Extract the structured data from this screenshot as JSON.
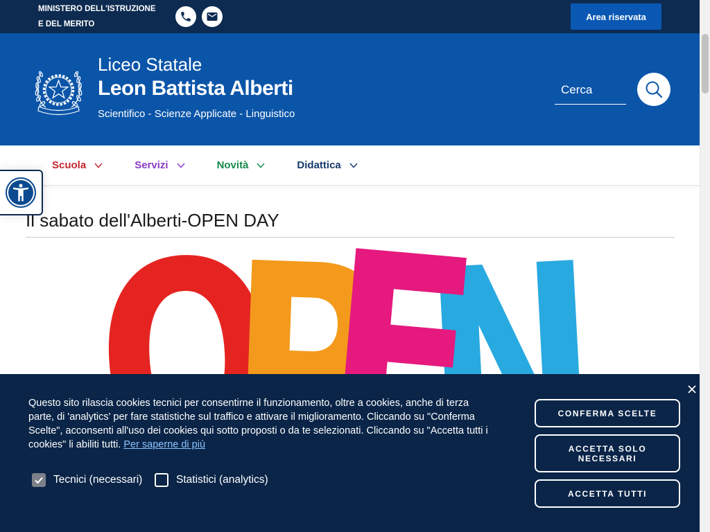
{
  "top_bar": {
    "ministry_line1": "MINISTERO DELL'ISTRUZIONE",
    "ministry_line2": "E DEL MERITO",
    "phone_icon": "phone-icon",
    "email_icon": "envelope-icon",
    "reserved_area_label": "Area riservata",
    "background": "#0d2b50"
  },
  "header": {
    "logo_icon": "italian-republic-emblem-icon",
    "kicker": "Liceo Statale",
    "school_name": "Leon Battista Alberti",
    "tagline": "Scientifico - Scienze Applicate - Linguistico",
    "search": {
      "label": "Cerca",
      "icon": "search-icon"
    },
    "background": "#0b55a9"
  },
  "nav": {
    "items": [
      {
        "label": "Scuola",
        "color": "#c1272d",
        "icon": "chevron-down-icon"
      },
      {
        "label": "Servizi",
        "color": "#8a3dc4",
        "icon": "chevron-down-icon"
      },
      {
        "label": "Novità",
        "color": "#17894b",
        "icon": "chevron-down-icon"
      },
      {
        "label": "Didattica",
        "color": "#173a6b",
        "icon": "chevron-down-icon"
      }
    ]
  },
  "accessibility_widget": {
    "icon": "accessibility-icon"
  },
  "article": {
    "title": "Il sabato dell'Alberti-OPEN DAY",
    "hero_image": {
      "letters": [
        "O",
        "P",
        "E",
        "N"
      ],
      "letter_colors": [
        "#e52421",
        "#f39a1c",
        "#e5197e",
        "#28a9e0"
      ]
    }
  },
  "cookie_banner": {
    "text": "Questo sito rilascia cookies tecnici per consentirne il funzionamento, oltre a cookies, anche di terza parte, di 'analytics' per fare statistiche sul traffico e attivare il miglioramento. Cliccando su \"Conferma Scelte\", acconsenti all'uso dei cookies qui sotto proposti o da te selezionati. Cliccando su \"Accetta tutti i cookies\" li abiliti tutti.",
    "link": "Per saperne di più",
    "close_icon": "close-icon",
    "options": [
      {
        "label": "Tecnici (necessari)",
        "checked": true
      },
      {
        "label": "Statistici (analytics)",
        "checked": false
      }
    ],
    "buttons": {
      "confirm": "CONFERMA SCELTE",
      "necessary_only": "ACCETTA SOLO NECESSARI",
      "accept_all": "ACCETTA TUTTI"
    },
    "background": "#0b2548"
  }
}
